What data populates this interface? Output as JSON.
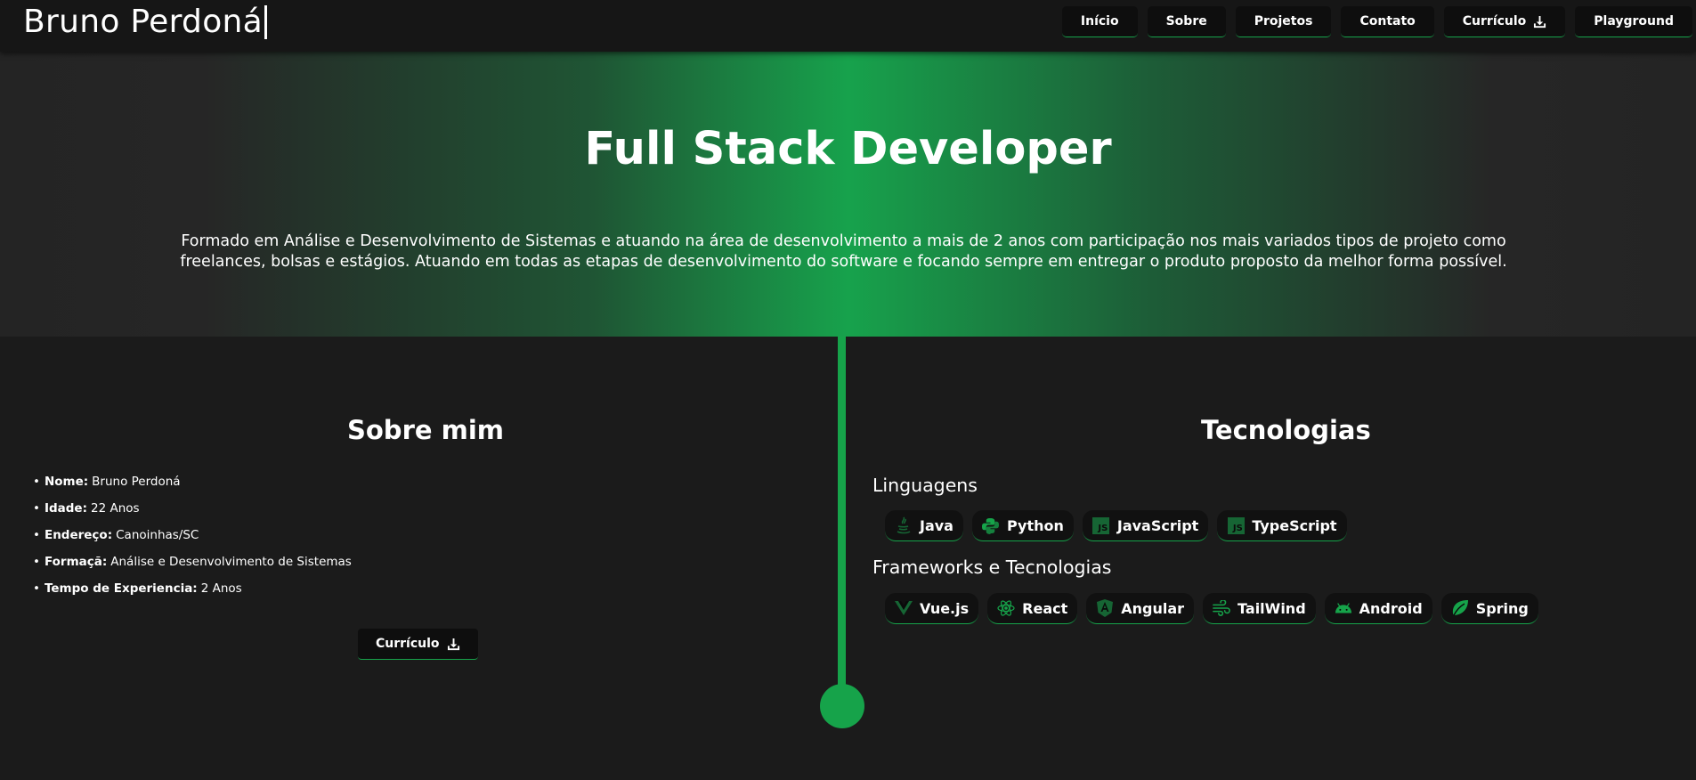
{
  "header": {
    "brand": "Bruno Perdoná",
    "nav": [
      {
        "label": "Início"
      },
      {
        "label": "Sobre"
      },
      {
        "label": "Projetos"
      },
      {
        "label": "Contato"
      },
      {
        "label": "Currículo",
        "icon": "download-icon"
      },
      {
        "label": "Playground"
      }
    ]
  },
  "hero": {
    "title": "Full Stack Developer",
    "description": "Formado em Análise e Desenvolvimento de Sistemas e atuando na área de desenvolvimento a mais de 2 anos com participação nos mais variados tipos de projeto como freelances, bolsas e estágios. Atuando em todas as etapas de desenvolvimento do software e focando sempre em entregar o produto proposto da melhor forma possível."
  },
  "about": {
    "title": "Sobre mim",
    "items": [
      {
        "label": "Nome:",
        "value": "Bruno Perdoná"
      },
      {
        "label": "Idade:",
        "value": "22 Anos"
      },
      {
        "label": "Endereço:",
        "value": "Canoinhas/SC"
      },
      {
        "label": "Formaçã:",
        "value": "Análise e Desenvolvimento de Sistemas"
      },
      {
        "label": "Tempo de Experiencia:",
        "value": "2 Anos"
      }
    ],
    "cv_button": "Currículo"
  },
  "tech": {
    "title": "Tecnologias",
    "languages_title": "Linguagens",
    "languages": [
      {
        "label": "Java",
        "icon": "java-icon"
      },
      {
        "label": "Python",
        "icon": "python-icon"
      },
      {
        "label": "JavaScript",
        "icon": "javascript-icon",
        "badge": "JS"
      },
      {
        "label": "TypeScript",
        "icon": "typescript-icon",
        "badge": "JS"
      }
    ],
    "frameworks_title": "Frameworks e Tecnologias",
    "frameworks": [
      {
        "label": "Vue.js",
        "icon": "vue-icon"
      },
      {
        "label": "React",
        "icon": "react-icon"
      },
      {
        "label": "Angular",
        "icon": "angular-icon"
      },
      {
        "label": "TailWind",
        "icon": "tailwind-icon"
      },
      {
        "label": "Android",
        "icon": "android-icon"
      },
      {
        "label": "Spring",
        "icon": "spring-icon"
      }
    ]
  },
  "colors": {
    "accent": "#16a34a",
    "background": "#1b1b1b",
    "header": "#161616",
    "button": "#0e0e0e"
  }
}
